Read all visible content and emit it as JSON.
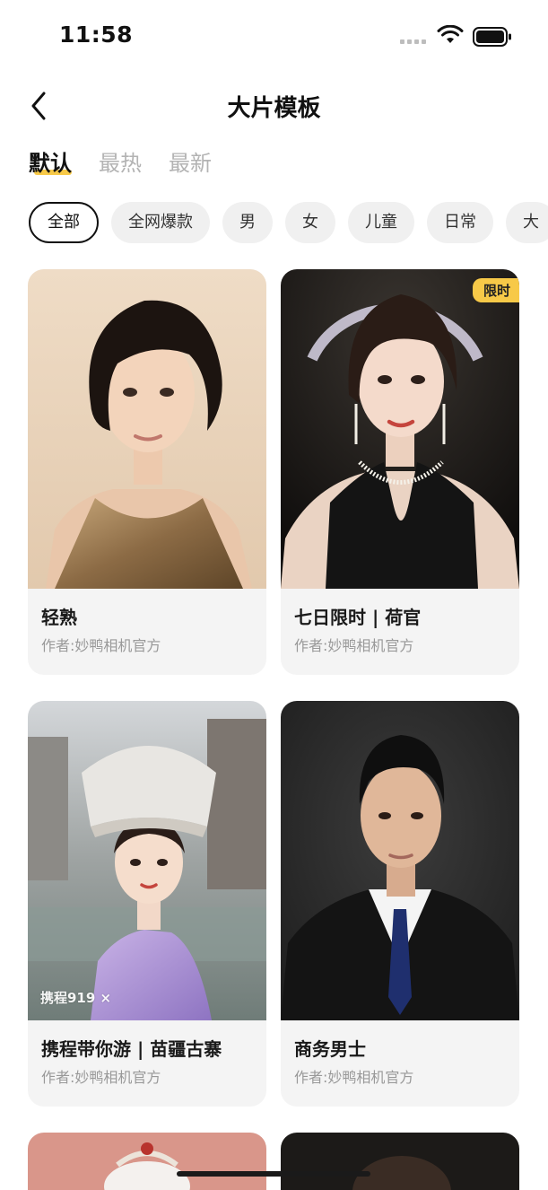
{
  "status_bar": {
    "time": "11:58"
  },
  "header": {
    "title": "大片模板"
  },
  "sort_tabs": [
    {
      "label": "默认",
      "active": true
    },
    {
      "label": "最热",
      "active": false
    },
    {
      "label": "最新",
      "active": false
    }
  ],
  "categories": [
    {
      "label": "全部",
      "active": true
    },
    {
      "label": "全网爆款"
    },
    {
      "label": "男"
    },
    {
      "label": "女"
    },
    {
      "label": "儿童"
    },
    {
      "label": "日常"
    },
    {
      "label": "大"
    }
  ],
  "templates": [
    {
      "title": "轻熟",
      "author": "作者:妙鸭相机官方"
    },
    {
      "title": "七日限时 | 荷官",
      "author": "作者:妙鸭相机官方",
      "badge": "限时"
    },
    {
      "title": "携程带你游 | 苗疆古寨",
      "author": "作者:妙鸭相机官方",
      "watermark": "携程919 ×"
    },
    {
      "title": "商务男士",
      "author": "作者:妙鸭相机官方"
    }
  ],
  "colors": {
    "accent": "#f7c948",
    "chip_bg": "#f0f0f0",
    "card_bg": "#f4f4f4"
  }
}
